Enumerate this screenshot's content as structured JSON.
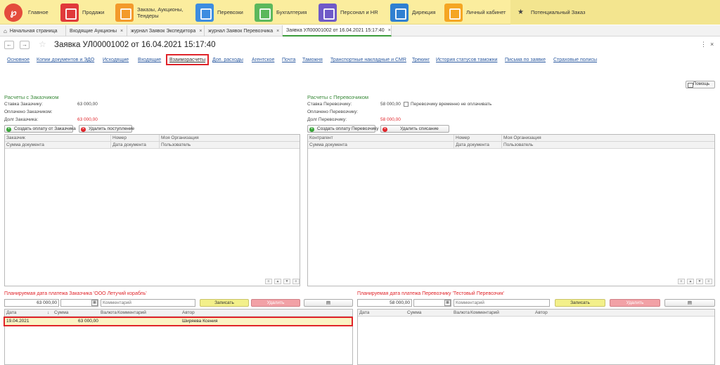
{
  "topbar": {
    "logo": "℘",
    "sections": [
      {
        "label": "Главное",
        "icon": "logo-icon",
        "color": "#e44b3c"
      },
      {
        "label": "Продажи",
        "icon": "cart-icon",
        "color": "#e0393a"
      },
      {
        "label": "Заказы, Аукционы, Тендеры",
        "icon": "gavel-icon",
        "color": "#f39a2b"
      },
      {
        "label": "Перевозки",
        "icon": "truck-icon",
        "color": "#3d8de0"
      },
      {
        "label": "Бухгалтерия",
        "icon": "calculator-icon",
        "color": "#5cb85c"
      },
      {
        "label": "Персонал и HR",
        "icon": "people-icon",
        "color": "#6f5ac8"
      },
      {
        "label": "Дирекция",
        "icon": "briefcase-icon",
        "color": "#2f80d1"
      },
      {
        "label": "Личный кабинет",
        "icon": "gear-icon",
        "color": "#f5a623"
      }
    ],
    "favorite_label": "Потенциальный Заказ"
  },
  "window_tabs": [
    {
      "label": "Начальная страница",
      "closable": false
    },
    {
      "label": "Входящие Аукционы",
      "closable": true
    },
    {
      "label": "журнал Заявок Экспедитора",
      "closable": true
    },
    {
      "label": "журнал Заявок Перевозчика",
      "closable": true
    },
    {
      "label": "Заявка УЛ00001002 от 16.04.2021 15:17:40",
      "closable": true,
      "active": true
    }
  ],
  "document": {
    "title": "Заявка УЛ00001002 от 16.04.2021 15:17:40",
    "tabs": [
      "Основное",
      "Копии документов и ЭДО",
      "Исходящие",
      "Входящие",
      "Взаиморасчеты",
      "Доп. расходы",
      "Агентское",
      "Почта",
      "Таможня",
      "Транспортные накладные и CMR",
      "Трекинг",
      "История статусов таможни",
      "Письма по заявке",
      "Страховые полисы"
    ],
    "active_tab": "Взаиморасчеты",
    "help_label": "Помощь"
  },
  "customer": {
    "header": "Расчеты с Заказчиком",
    "rate_label": "Ставка Заказчику:",
    "rate_value": "63 000,00",
    "paid_label": "Оплачено Заказчиком:",
    "debt_label": "Долг Заказчика:",
    "debt_value": "63 000,00",
    "create_btn": "Создать оплату от Заказчика",
    "delete_btn": "Удалить поступление",
    "grid_headers_1": [
      "Заказчик",
      "Номер",
      "Моя Организация"
    ],
    "grid_headers_2": [
      "Сумма документа",
      "Дата документа",
      "Пользователь"
    ],
    "plan_header": "Планируемая дата платежа Заказчика 'ООО Летучий корабль'",
    "plan_amount": "63 000,00",
    "comment_placeholder": "Комментарий",
    "save_btn": "Записать",
    "remove_btn": "Удалить",
    "plan_headers": [
      "Дата",
      "Сумма",
      "Валюта",
      "Комментарий",
      "Автор"
    ],
    "plan_rows": [
      {
        "date": "19.04.2021",
        "amount": "63 000,00",
        "currency": "",
        "comment": "",
        "author": "Ширяева Ксения"
      }
    ]
  },
  "carrier": {
    "header": "Расчеты с Перевозчиком",
    "rate_label": "Ставка Перевозчику:",
    "rate_value": "58 000,00",
    "no_pay_label": "Перевозчику временно не оплачивать",
    "paid_label": "Оплачено Перевозчику:",
    "debt_label": "Долг Перевозчику:",
    "debt_value": "58 000,00",
    "create_btn": "Создать оплату Перевозчику",
    "delete_btn": "Удалить списание",
    "grid_headers_1": [
      "Контрагент",
      "Номер",
      "Моя Организация"
    ],
    "grid_headers_2": [
      "Сумма документа",
      "Дата документа",
      "Пользователь"
    ],
    "plan_header": "Планируемая дата платежа Перевозчику 'Тестовый Перевозчик'",
    "plan_amount": "58 000,00",
    "comment_placeholder": "Комментарий",
    "save_btn": "Записать",
    "remove_btn": "Удалить",
    "plan_headers": [
      "Дата",
      "Сумма",
      "Валюта",
      "Комментарий",
      "Автор"
    ]
  },
  "colors": {
    "accent_red": "#e0242a",
    "header_green": "#3a8a3a",
    "topbar": "#fbed9e",
    "save_yellow": "#f3f08a",
    "remove_pink": "#f2a1a6"
  }
}
